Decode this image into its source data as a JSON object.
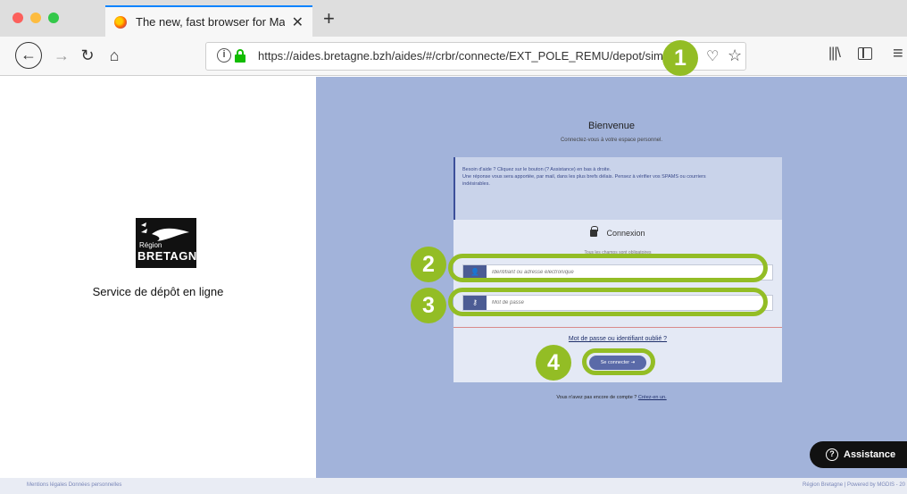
{
  "browser": {
    "tab_title": "The new, fast browser for Mac,",
    "url": "https://aides.bretagne.bzh/aides/#/crbr/connecte/EXT_POLE_REMU/depot/simple"
  },
  "left": {
    "logo_small": "Région",
    "logo_big": "BRETAGNE",
    "service_title": "Service de dépôt en ligne"
  },
  "main": {
    "welcome": "Bienvenue",
    "welcome_sub": "Connectez-vous à votre espace personnel.",
    "help_line1": "Besoin d'aide ? Cliquez sur le bouton (? Assistance) en bas à droite.",
    "help_line2": "Une réponse vous sera apportée, par mail, dans les plus brefs délais. Pensez à vérifier vos SPAMS ou courriers",
    "help_line3": "indésirables.",
    "card_title": "Connexion",
    "faint_label": "Tous les champs sont obligatoires",
    "id_placeholder": "Identifiant ou adresse électronique",
    "pw_placeholder": "Mot de passe",
    "forgot": "Mot de passe ou identifiant oublié ?",
    "login_button": "Se connecter ⇥",
    "signup_text": "Vous n'avez pas encore de compte ?",
    "signup_link": "Créez-en un."
  },
  "assistance": "Assistance",
  "footer": {
    "left": "Mentions légales   Données personnelles",
    "right": "Région Bretagne | Powered by MGDIS - 20"
  },
  "callouts": [
    "1",
    "2",
    "3",
    "4"
  ],
  "accent_color": "#93bd25"
}
